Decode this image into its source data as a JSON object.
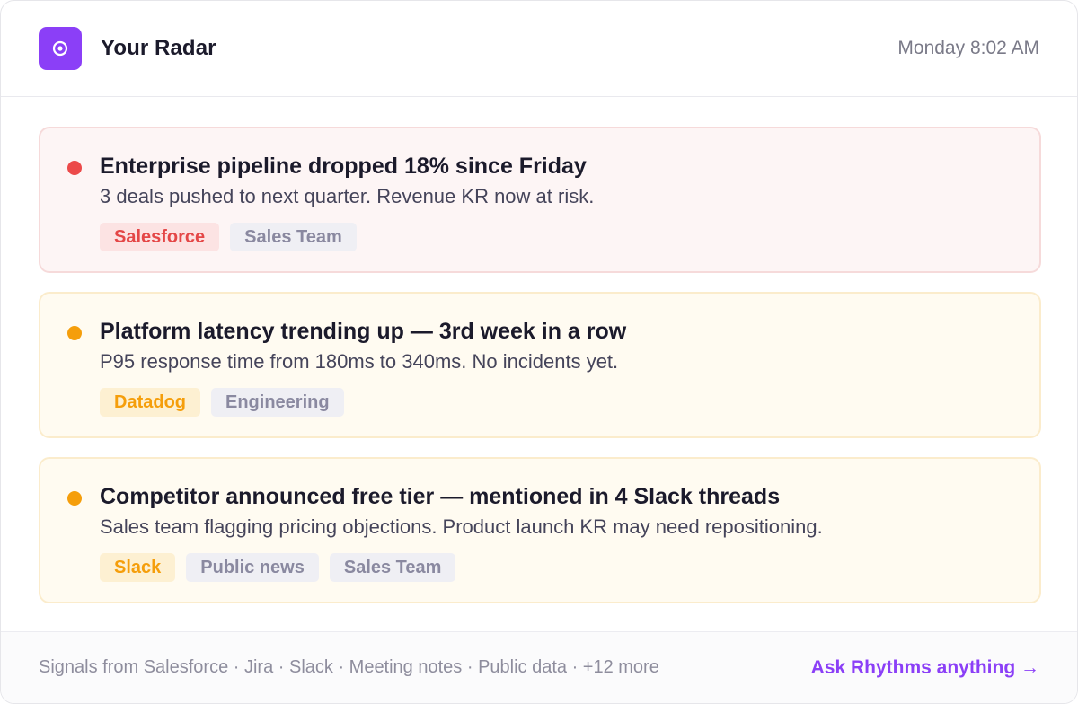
{
  "header": {
    "title": "Your Radar",
    "time": "Monday 8:02 AM",
    "logo_icon": "radar-target-icon"
  },
  "cards": [
    {
      "severity": "critical",
      "title": "Enterprise pipeline dropped 18% since Friday",
      "description": "3 deals pushed to next quarter. Revenue KR now at risk.",
      "tags": [
        {
          "label": "Salesforce",
          "style": "red"
        },
        {
          "label": "Sales Team",
          "style": "neutral"
        }
      ]
    },
    {
      "severity": "warning",
      "title": "Platform latency trending up — 3rd week in a row",
      "description": "P95 response time from 180ms to 340ms. No incidents yet.",
      "tags": [
        {
          "label": "Datadog",
          "style": "orange"
        },
        {
          "label": "Engineering",
          "style": "neutral"
        }
      ]
    },
    {
      "severity": "warning",
      "title": "Competitor announced free tier — mentioned in 4 Slack threads",
      "description": "Sales team flagging pricing objections. Product launch KR may need repositioning.",
      "tags": [
        {
          "label": "Slack",
          "style": "orange"
        },
        {
          "label": "Public news",
          "style": "neutral"
        },
        {
          "label": "Sales Team",
          "style": "neutral"
        }
      ]
    }
  ],
  "footer": {
    "sources": "Signals from Salesforce · Jira · Slack · Meeting notes · Public data · +12 more",
    "cta": "Ask Rhythms anything →"
  },
  "colors": {
    "accent": "#8b3ff7",
    "critical": "#ec4a4a",
    "warning": "#f59e0b"
  }
}
